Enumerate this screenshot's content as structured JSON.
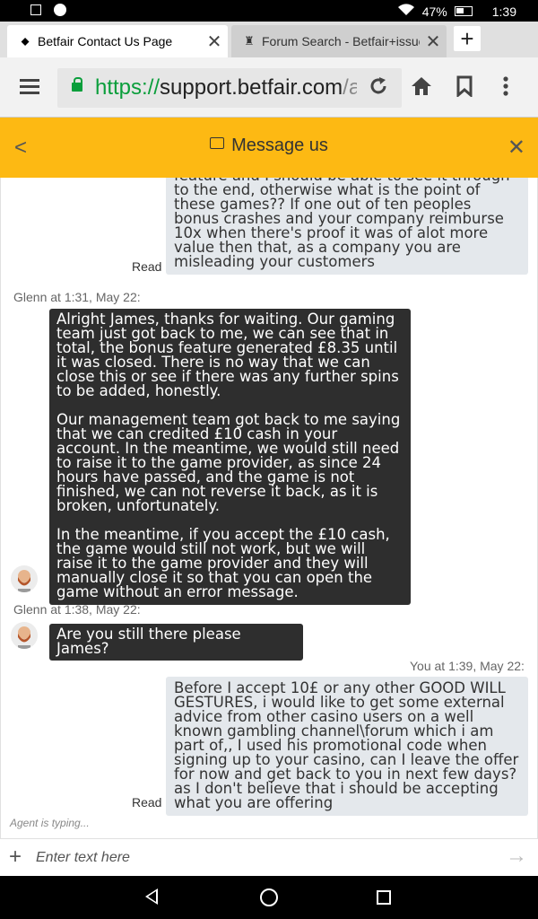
{
  "status_bar": {
    "battery": "47%",
    "time": "1:39"
  },
  "tabs": [
    {
      "title": "Betfair Contact Us Page",
      "active": true
    },
    {
      "title": "Forum Search - Betfair+issue",
      "active": false
    }
  ],
  "toolbar": {
    "url_scheme": "https://",
    "url_host": "support.betfair.com",
    "url_path": "/app/chat"
  },
  "header": {
    "title": "Message us"
  },
  "messages": {
    "m1_text": "feature and I should be able to see it through to the end, otherwise what is the point of these games?? If one out of ten peoples bonus crashes and your company reimburse 10x when there's proof it was of alot more value then that, as a company you are misleading your customers",
    "m1_status": "Read",
    "m2_meta": "Glenn at 1:31, May 22:",
    "m2_p1": "Alright James, thanks for waiting. Our gaming team just got back to me, we can see that in total, the bonus feature generated £8.35 until it was closed. There is no way that we can close this or see if there was any further spins to be added, honestly.",
    "m2_p2": "Our management team got back to me saying that we can credited £10 cash in your account. In the meantime, we would still need to raise it to the game provider, as since 24 hours have passed, and the game is not finished, we can not reverse it back, as it is broken, unfortunately.",
    "m2_p3": "In the meantime, if you accept the £10 cash, the game would still not work, but we will raise it to the game provider and they will manually close it so that you can open the game without an error message.",
    "m3_meta": "Glenn at 1:38, May 22:",
    "m3_text": "Are you still there please James?",
    "m4_meta": "You at 1:39, May 22:",
    "m4_text": "Before I accept 10£ or any other GOOD WILL GESTURES, i would like to get some external advice from other casino users on a well known gambling channel\\forum which i am part of,, I used his promotional code when signing up to your casino, can I leave the offer for now and get back to you in next few days? as I don't believe that i should be accepting what you are offering",
    "m4_status": "Read"
  },
  "typing_indicator": "Agent is typing...",
  "input": {
    "placeholder": "Enter text here"
  },
  "colors": {
    "header_bg": "#fdb913",
    "agent_bubble": "#2e2e2e",
    "user_bubble": "#e4e8ec",
    "url_green": "#0a9e3b"
  }
}
